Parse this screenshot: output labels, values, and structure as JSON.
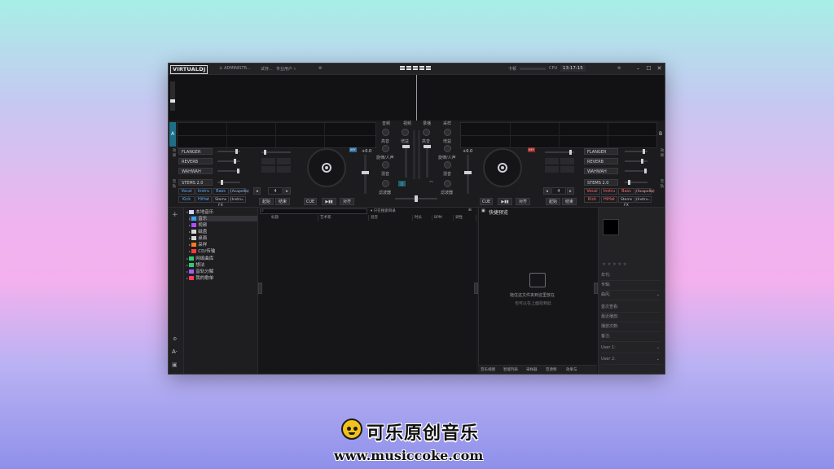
{
  "titlebar": {
    "logo": "VIRTUALDJ",
    "user": "ADMINISTR...",
    "item2": "试存...",
    "mode": "专业用户",
    "mode_arrow": "▿",
    "gear": "⚙",
    "mid_label": "卡顿",
    "cpu_label": "CPU",
    "clock": "13:17:15",
    "min": "–",
    "max": "☐",
    "close": "✕"
  },
  "decks": {
    "left": {
      "label": "A",
      "fx": [
        "FLANGER",
        "REVERB",
        "WAHWAH"
      ],
      "stems_label": "STEMS 2.0",
      "stem_pads_top": [
        "Vocal",
        "Instru",
        "Bass",
        "(Acapella)"
      ],
      "stem_pads_bottom": [
        "Kick",
        "HiHat",
        "Stems FX",
        "(Instru...)"
      ],
      "pitch": "+0.0",
      "loop": "4",
      "cue": "CUE",
      "play": "▶▮▮",
      "sync": "对齐",
      "in": "起始",
      "out": "结束"
    },
    "right": {
      "label": "B",
      "fx": [
        "FLANGER",
        "REVERB",
        "WAHWAH"
      ],
      "stems_label": "STEMS 2.0",
      "stem_pads_top": [
        "Vocal",
        "Instru",
        "Bass",
        "(Acapella)"
      ],
      "stem_pads_bottom": [
        "Kick",
        "HiHat",
        "Stems FX",
        "(Instru...)"
      ],
      "pitch": "+0.0",
      "loop": "4",
      "cue": "CUE",
      "play": "▶▮▮",
      "sync": "对齐",
      "in": "起始",
      "out": "结束"
    }
  },
  "mixer": {
    "top_tabs": [
      "音频",
      "视频",
      "录播",
      "采样"
    ],
    "knobs_left": [
      "高音",
      "增益",
      "低音",
      "旋律/人声",
      "混音"
    ],
    "knobs_right": [
      "增益",
      "高音",
      "低音",
      "旋律/人声",
      "混音"
    ],
    "filter": "滤波器"
  },
  "browser": {
    "tree": [
      {
        "label": "本地音乐",
        "color": "#9aa0ff"
      },
      {
        "label": "音乐",
        "color": "#2ea2ff"
      },
      {
        "label": "视频",
        "color": "#b44dff"
      },
      {
        "label": "磁盘",
        "color": "#d8d8d8"
      },
      {
        "label": "桌面",
        "color": "#d8d8d8"
      },
      {
        "label": "采样",
        "color": "#ff7a1a"
      },
      {
        "label": "CD/传输",
        "color": "#ff3b3b"
      },
      {
        "label": "网络曲库",
        "color": "#2ecc71"
      },
      {
        "label": "想法",
        "color": "#2ecc71"
      },
      {
        "label": "音轨分解",
        "color": "#a35cff"
      },
      {
        "label": "我的歌单",
        "color": "#ff3b5c"
      }
    ],
    "search_placeholder": "",
    "filter_label": "只在搜索目录",
    "columns": [
      "标题",
      "艺术家",
      "混音",
      "时长",
      "BPM",
      "调性"
    ],
    "preview_title": "快捷预览",
    "preview_empty": "拖住这文件夹到这里放在",
    "preview_sub": "也可以在上面找到此",
    "preview_tabs": [
      "音乐视图",
      "智能列表",
      "采样器",
      "音源频",
      "效果与"
    ],
    "info_rows": [
      "年代:",
      "专辑:",
      "曲风:",
      "首次查看:",
      "最近播放:",
      "播放次数:",
      "备注:",
      "User 1:",
      "User 2:"
    ],
    "stars": "★★★★★",
    "side_plus": "+",
    "side_a": "A·"
  },
  "watermark": {
    "title": "可乐原创音乐",
    "url": "www.musiccoke.com"
  }
}
